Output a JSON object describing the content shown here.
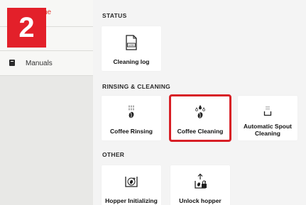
{
  "step_badge": "2",
  "sidebar": {
    "home_label": "ne",
    "manuals_label": "Manuals"
  },
  "sections": {
    "status": "STATUS",
    "rinsing": "RINSING & CLEANING",
    "other": "OTHER"
  },
  "cards": {
    "cleaning_log": "Cleaning log",
    "cleaning_log_icon_text": "LOG",
    "coffee_rinsing": "Coffee Rinsing",
    "coffee_cleaning": "Coffee Cleaning",
    "auto_spout_line1": "Automatic Spout",
    "auto_spout_line2": "Cleaning",
    "hopper_initializing": "Hopper Initializing",
    "unlock_hopper": "Unlock hopper"
  },
  "selected_card": "coffee_cleaning",
  "colors": {
    "accent": "#e3202a",
    "selection": "#d81f26"
  }
}
